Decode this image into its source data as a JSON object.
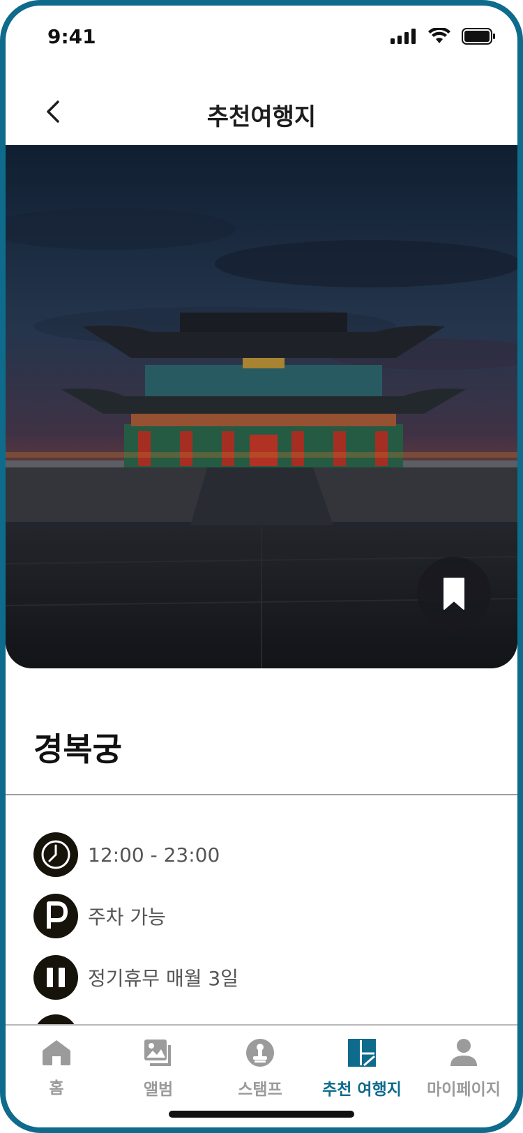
{
  "status_bar": {
    "time": "9:41"
  },
  "nav": {
    "title": "추천여행지"
  },
  "place": {
    "name": "경복궁",
    "hours": "12:00 - 23:00",
    "parking": "주차 가능",
    "closed": "정기휴무 매월 3일"
  },
  "tabs": [
    {
      "label": "홈",
      "icon": "home-icon",
      "active": false
    },
    {
      "label": "앨범",
      "icon": "album-icon",
      "active": false
    },
    {
      "label": "스탬프",
      "icon": "stamp-icon",
      "active": false
    },
    {
      "label": "추천 여행지",
      "icon": "map-icon",
      "active": true
    },
    {
      "label": "마이페이지",
      "icon": "person-icon",
      "active": false
    }
  ],
  "colors": {
    "accent": "#0e6b8c",
    "inactive": "#9b9b9b",
    "icon_bg": "#16130b"
  }
}
